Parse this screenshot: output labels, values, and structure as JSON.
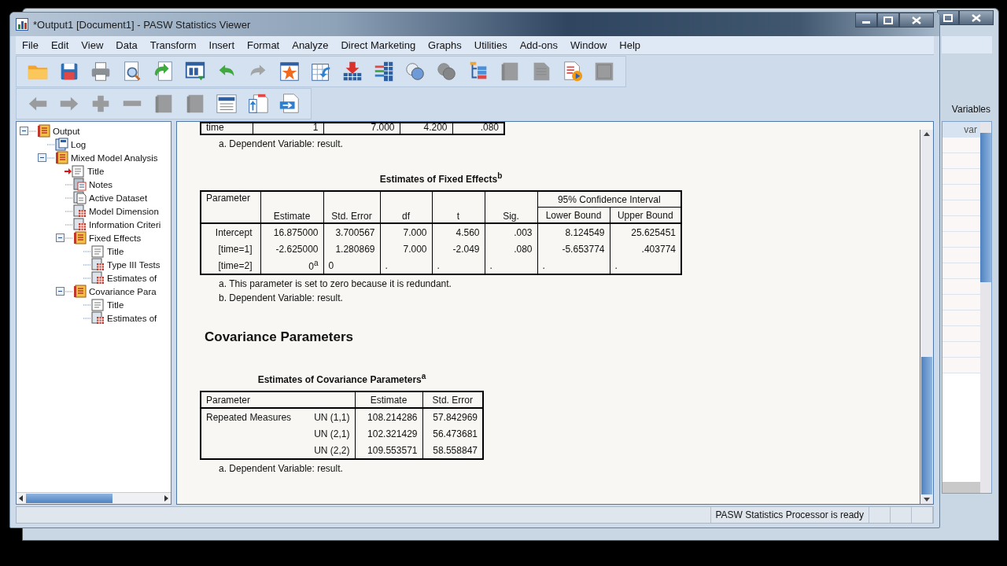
{
  "window": {
    "title": "*Output1 [Document1] - PASW Statistics Viewer"
  },
  "menu": [
    "File",
    "Edit",
    "View",
    "Data",
    "Transform",
    "Insert",
    "Format",
    "Analyze",
    "Direct Marketing",
    "Graphs",
    "Utilities",
    "Add-ons",
    "Window",
    "Help"
  ],
  "toolbar_1": [
    {
      "kind": "folder",
      "disabled": false
    },
    {
      "kind": "floppy-disk",
      "disabled": false
    },
    {
      "kind": "printer",
      "disabled": false
    },
    {
      "kind": "magnifier-page",
      "disabled": false
    },
    {
      "kind": "arrow-page",
      "disabled": false
    },
    {
      "kind": "dialog-window",
      "disabled": false
    },
    {
      "kind": "undo",
      "disabled": false
    },
    {
      "kind": "redo",
      "disabled": true
    },
    {
      "kind": "star-grid",
      "disabled": false
    },
    {
      "kind": "arrow-grid",
      "disabled": false
    },
    {
      "kind": "down-arrow-grid",
      "disabled": false
    },
    {
      "kind": "bars-grid",
      "disabled": false
    },
    {
      "kind": "circles",
      "disabled": false
    },
    {
      "kind": "circles",
      "disabled": true
    },
    {
      "kind": "tree-list",
      "disabled": false
    },
    {
      "kind": "book",
      "disabled": true
    },
    {
      "kind": "page",
      "disabled": true
    },
    {
      "kind": "play-page",
      "disabled": false
    },
    {
      "kind": "square",
      "disabled": true
    }
  ],
  "toolbar_2": [
    {
      "kind": "arrow-left",
      "disabled": true
    },
    {
      "kind": "arrow-right",
      "disabled": true
    },
    {
      "kind": "plus",
      "disabled": true
    },
    {
      "kind": "minus",
      "disabled": true
    },
    {
      "kind": "book",
      "disabled": true
    },
    {
      "kind": "book",
      "disabled": true
    },
    {
      "kind": "dropdown-page",
      "disabled": false
    },
    {
      "kind": "up-arrow-page",
      "disabled": false
    },
    {
      "kind": "right-arrow-page",
      "disabled": false
    }
  ],
  "tree": [
    {
      "label": "Output",
      "kind": "book",
      "current": false,
      "expanded": true,
      "children": [
        {
          "label": "Log",
          "kind": "log",
          "current": false
        },
        {
          "label": "Mixed Model Analysis",
          "kind": "book",
          "current": false,
          "expanded": true,
          "children": [
            {
              "label": "Title",
              "kind": "title",
              "current": true
            },
            {
              "label": "Notes",
              "kind": "notes",
              "current": false
            },
            {
              "label": "Active Dataset",
              "kind": "page",
              "current": false
            },
            {
              "label": "Model Dimension",
              "kind": "table",
              "current": false
            },
            {
              "label": "Information Criteri",
              "kind": "table",
              "current": false
            },
            {
              "label": "Fixed Effects",
              "kind": "book",
              "current": false,
              "expanded": true,
              "children": [
                {
                  "label": "Title",
                  "kind": "title",
                  "current": false
                },
                {
                  "label": "Type III Tests",
                  "kind": "table",
                  "current": false
                },
                {
                  "label": "Estimates of",
                  "kind": "table",
                  "current": false
                }
              ]
            },
            {
              "label": "Covariance Para",
              "kind": "book",
              "current": false,
              "expanded": true,
              "children": [
                {
                  "label": "Title",
                  "kind": "title",
                  "current": false
                },
                {
                  "label": "Estimates of",
                  "kind": "table",
                  "current": false
                }
              ]
            }
          ]
        }
      ]
    }
  ],
  "output": {
    "partial_table": {
      "rows": [
        [
          "time",
          "1",
          "7.000",
          "4.200",
          ".080"
        ]
      ],
      "footnotes": [
        "a. Dependent Variable: result."
      ]
    },
    "fixed_effects": {
      "title": "Estimates of Fixed Effects$^{b}$",
      "columns": [
        "Parameter",
        "Estimate",
        "Std. Error",
        "df",
        "t",
        "Sig."
      ],
      "group_header": "95% Confidence Interval",
      "group_columns": [
        "Lower Bound",
        "Upper Bound"
      ],
      "rows": [
        [
          "Intercept",
          "16.875000",
          "3.700567",
          "7.000",
          "4.560",
          ".003",
          "8.124549",
          "25.625451"
        ],
        [
          "[time=1]",
          "-2.625000",
          "1.280869",
          "7.000",
          "-2.049",
          ".080",
          "-5.653774",
          ".403774"
        ],
        [
          "[time=2]",
          "0$^{a}$",
          "0",
          ".",
          ".",
          ".",
          ".",
          "."
        ]
      ],
      "footnotes": [
        "a. This parameter is set to zero because it is redundant.",
        "b. Dependent Variable: result."
      ]
    },
    "heading": "Covariance Parameters",
    "covariance": {
      "title": "Estimates of Covariance Parameters$^{a}$",
      "columns": [
        "Parameter",
        "Estimate",
        "Std. Error"
      ],
      "rows": [
        {
          "parameter": "Repeated Measures",
          "term": "UN (1,1)",
          "values": [
            "108.214286",
            "57.842969"
          ]
        },
        {
          "term": "UN (2,1)",
          "values": [
            "102.321429",
            "56.473681"
          ]
        },
        {
          "term": "UN (2,2)",
          "values": [
            "109.553571",
            "58.558847"
          ]
        }
      ],
      "footnotes": [
        "a. Dependent Variable: result."
      ]
    }
  },
  "status_bar": "PASW Statistics Processor is ready",
  "back_window": {
    "panel_label": "Variables",
    "column_header": "var"
  }
}
